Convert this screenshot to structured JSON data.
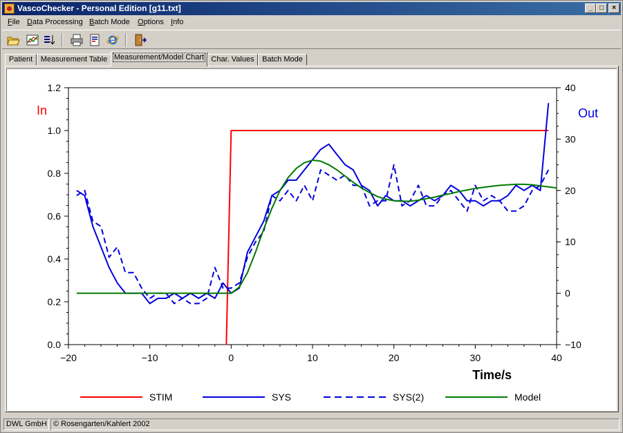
{
  "window": {
    "title": "VascoChecker - Personal Edition [g11.txt]",
    "controls": {
      "minimize": "_",
      "maximize": "□",
      "close": "×"
    }
  },
  "menu": [
    "File",
    "Data Processing",
    "Batch Mode",
    "Options",
    "Info"
  ],
  "toolbar": {
    "buttons": [
      "open-folder-icon",
      "data-chart-icon",
      "sort-list-icon",
      "printer-icon",
      "report-icon",
      "internet-explorer-icon",
      "exit-door-icon"
    ]
  },
  "tabs": [
    {
      "label": "Patient",
      "active": false
    },
    {
      "label": "Measurement Table",
      "active": false
    },
    {
      "label": "Measurement/Model Chart",
      "active": true
    },
    {
      "label": "Char. Values",
      "active": false
    },
    {
      "label": "Batch Mode",
      "active": false
    }
  ],
  "status": {
    "company": "DWL GmbH",
    "copyright": "© Rosengarten/Kahlert 2002"
  },
  "colors": {
    "stim": "#ff0000",
    "sys": "#0000dd",
    "model": "#007a00",
    "in_label": "#ff0000",
    "out_label": "#0000dd"
  },
  "chart_data": {
    "type": "line",
    "xlabel": "Time/s",
    "left_axis_label": "In",
    "right_axis_label": "Out",
    "xlim": [
      -20,
      40
    ],
    "ylim_left": [
      0.0,
      1.2
    ],
    "ylim_right": [
      -10,
      40
    ],
    "x_ticks": [
      -20,
      -10,
      0,
      10,
      20,
      30,
      40
    ],
    "x_tick_labels": [
      "−20",
      "−10",
      "0",
      "10",
      "20",
      "30",
      "40"
    ],
    "y_left_ticks": [
      0.0,
      0.2,
      0.4,
      0.6,
      0.8,
      1.0,
      1.2
    ],
    "y_left_tick_labels": [
      "0.0",
      "0.2",
      "0.4",
      "0.6",
      "0.8",
      "1.0",
      "1.2"
    ],
    "y_right_ticks": [
      -10,
      0,
      10,
      20,
      30,
      40
    ],
    "y_right_tick_labels": [
      "−10",
      "0",
      "10",
      "20",
      "30",
      "40"
    ],
    "grid": false,
    "legend_position": "bottom",
    "series": [
      {
        "name": "STIM",
        "axis": "left",
        "style": "solid",
        "color": "#ff0000",
        "x": [
          -0.6,
          0,
          0.1,
          39
        ],
        "y": [
          0.0,
          1.0,
          1.0,
          1.0
        ]
      },
      {
        "name": "SYS",
        "axis": "right",
        "style": "solid",
        "color": "#0000dd",
        "x": [
          -19,
          -18,
          -17,
          -16,
          -15,
          -14,
          -13,
          -12,
          -11,
          -10,
          -9,
          -8,
          -7,
          -6,
          -5,
          -4,
          -3,
          -2,
          -1,
          0,
          1,
          2,
          3,
          4,
          5,
          6,
          7,
          8,
          9,
          10,
          11,
          12,
          13,
          14,
          15,
          16,
          17,
          18,
          19,
          20,
          21,
          22,
          23,
          24,
          25,
          26,
          27,
          28,
          29,
          30,
          31,
          32,
          33,
          34,
          35,
          36,
          37,
          38,
          39
        ],
        "y": [
          20,
          19,
          13,
          9,
          5,
          2,
          0,
          0,
          0,
          -2,
          -1,
          -1,
          0,
          -1,
          0,
          -1,
          0,
          -1,
          2,
          0,
          1,
          8,
          11,
          14,
          19,
          20,
          22,
          22,
          24,
          26,
          28,
          29,
          27,
          25,
          24,
          21,
          20,
          17,
          19,
          18,
          18,
          17,
          18,
          19,
          18,
          19,
          21,
          20,
          18,
          18,
          17,
          18,
          18,
          19,
          21,
          20,
          21,
          20,
          37
        ]
      },
      {
        "name": "SYS(2)",
        "axis": "right",
        "style": "dashed",
        "color": "#0000dd",
        "x": [
          -19,
          -18,
          -17,
          -16,
          -15,
          -14,
          -13,
          -12,
          -11,
          -10,
          -9,
          -8,
          -7,
          -6,
          -5,
          -4,
          -3,
          -2,
          -1,
          0,
          1,
          2,
          3,
          4,
          5,
          6,
          7,
          8,
          9,
          10,
          11,
          12,
          13,
          14,
          15,
          16,
          17,
          18,
          19,
          20,
          21,
          22,
          23,
          24,
          25,
          26,
          27,
          28,
          29,
          30,
          31,
          32,
          33,
          34,
          35,
          36,
          37,
          38,
          39
        ],
        "y": [
          19,
          20,
          14,
          13,
          7,
          9,
          4,
          4,
          1,
          -1,
          0,
          0,
          -2,
          -1,
          -2,
          -2,
          -1,
          5,
          1,
          1,
          2,
          7,
          10,
          12,
          19,
          18,
          20,
          18,
          21,
          18,
          24,
          23,
          22,
          23,
          21,
          21,
          17,
          18,
          18,
          25,
          17,
          18,
          21,
          17,
          17,
          19,
          20,
          18,
          16,
          21,
          18,
          19,
          18,
          16,
          16,
          17,
          20,
          21,
          24
        ]
      },
      {
        "name": "Model",
        "axis": "right",
        "style": "solid",
        "color": "#007a00",
        "x": [
          -19,
          -1,
          0,
          1,
          2,
          3,
          4,
          5,
          6,
          7,
          8,
          9,
          10,
          11,
          12,
          13,
          14,
          15,
          16,
          17,
          18,
          19,
          20,
          21,
          22,
          23,
          24,
          25,
          26,
          27,
          28,
          29,
          30,
          31,
          32,
          33,
          34,
          35,
          36,
          37,
          38,
          39,
          40
        ],
        "y": [
          0,
          0,
          0,
          1.2,
          4,
          8,
          12.5,
          16.5,
          20,
          22.5,
          24.3,
          25.4,
          25.9,
          25.7,
          25,
          24,
          22.8,
          21.6,
          20.5,
          19.6,
          18.8,
          18.3,
          18,
          17.9,
          17.9,
          18.1,
          18.4,
          18.7,
          19.1,
          19.4,
          19.8,
          20.1,
          20.4,
          20.6,
          20.8,
          21,
          21.1,
          21.2,
          21.2,
          21.1,
          20.9,
          20.7,
          20.5
        ]
      }
    ]
  }
}
